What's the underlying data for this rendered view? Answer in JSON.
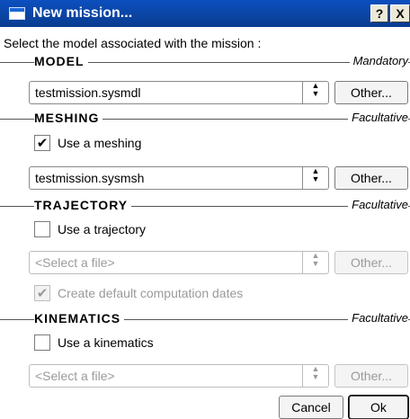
{
  "window": {
    "title": "New mission...",
    "help_label": "?",
    "close_label": "X"
  },
  "prompt": "Select the model associated with the mission :",
  "model": {
    "title": "MODEL",
    "tag": "Mandatory",
    "file": "testmission.sysmdl",
    "other_label": "Other..."
  },
  "meshing": {
    "title": "MESHING",
    "tag": "Facultative",
    "checkbox_label": "Use a meshing",
    "checked": true,
    "file": "testmission.sysmsh",
    "other_label": "Other..."
  },
  "trajectory": {
    "title": "TRAJECTORY",
    "tag": "Facultative",
    "checkbox_label": "Use a trajectory",
    "checked": false,
    "file": "<Select a file>",
    "other_label": "Other...",
    "default_dates_label": "Create default computation dates",
    "default_dates_checked": true
  },
  "kinematics": {
    "title": "KINEMATICS",
    "tag": "Facultative",
    "checkbox_label": "Use a kinematics",
    "checked": false,
    "file": "<Select a file>",
    "other_label": "Other..."
  },
  "footer": {
    "cancel_label": "Cancel",
    "ok_label": "Ok"
  },
  "icons": {
    "dropdown": "updown-arrows-icon",
    "check": "checkmark-icon"
  }
}
